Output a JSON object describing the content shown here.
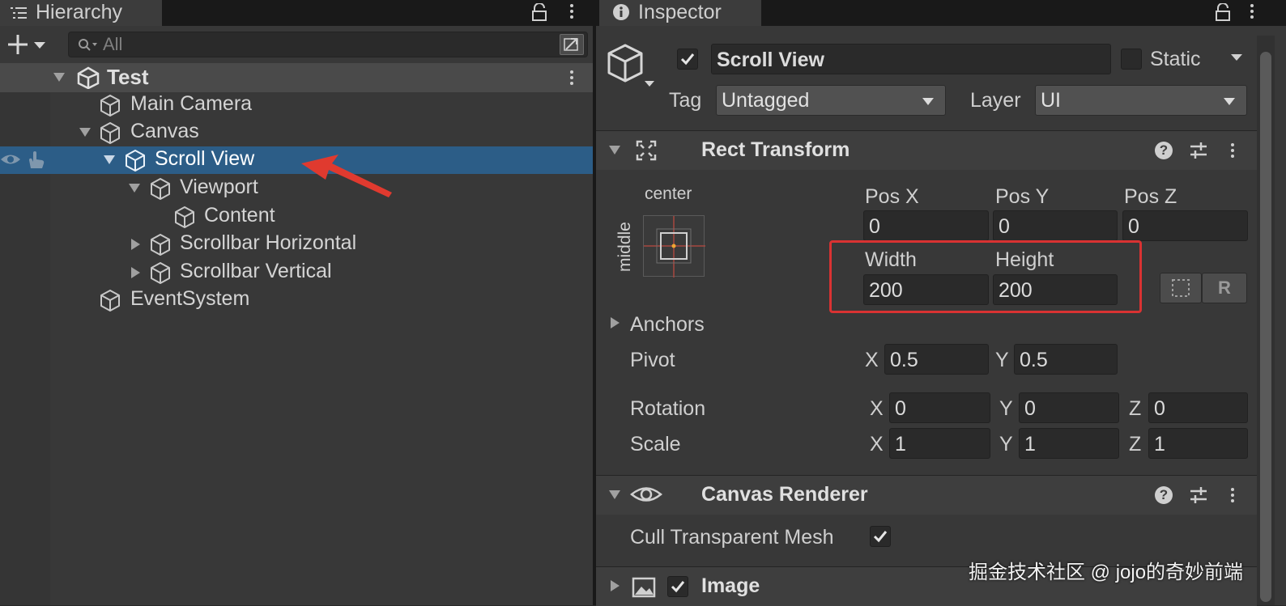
{
  "hierarchy": {
    "tab_label": "Hierarchy",
    "search_placeholder": "All",
    "scene_name": "Test",
    "items": [
      {
        "label": "Main Camera"
      },
      {
        "label": "Canvas"
      },
      {
        "label": "Scroll View"
      },
      {
        "label": "Viewport"
      },
      {
        "label": "Content"
      },
      {
        "label": "Scrollbar Horizontal"
      },
      {
        "label": "Scrollbar Vertical"
      },
      {
        "label": "EventSystem"
      }
    ]
  },
  "inspector": {
    "tab_label": "Inspector",
    "object_name": "Scroll View",
    "static_label": "Static",
    "tag_label": "Tag",
    "tag_value": "Untagged",
    "layer_label": "Layer",
    "layer_value": "UI",
    "rect_transform": {
      "title": "Rect Transform",
      "anchor_h": "center",
      "anchor_v": "middle",
      "pos_x_label": "Pos X",
      "pos_x": "0",
      "pos_y_label": "Pos Y",
      "pos_y": "0",
      "pos_z_label": "Pos Z",
      "pos_z": "0",
      "width_label": "Width",
      "width": "200",
      "height_label": "Height",
      "height": "200",
      "r_button": "R",
      "anchors_label": "Anchors",
      "pivot_label": "Pivot",
      "pivot_x": "0.5",
      "pivot_y": "0.5",
      "rotation_label": "Rotation",
      "rotation_x": "0",
      "rotation_y": "0",
      "rotation_z": "0",
      "scale_label": "Scale",
      "scale_x": "1",
      "scale_y": "1",
      "scale_z": "1",
      "axis_x": "X",
      "axis_y": "Y",
      "axis_z": "Z"
    },
    "canvas_renderer": {
      "title": "Canvas Renderer",
      "cull_label": "Cull Transparent Mesh"
    },
    "image": {
      "title": "Image"
    }
  },
  "watermark": "掘金技术社区 @ jojo的奇妙前端",
  "colors": {
    "selection": "#2c5d87",
    "highlight_box": "#d93232",
    "arrow": "#e03a2f"
  }
}
